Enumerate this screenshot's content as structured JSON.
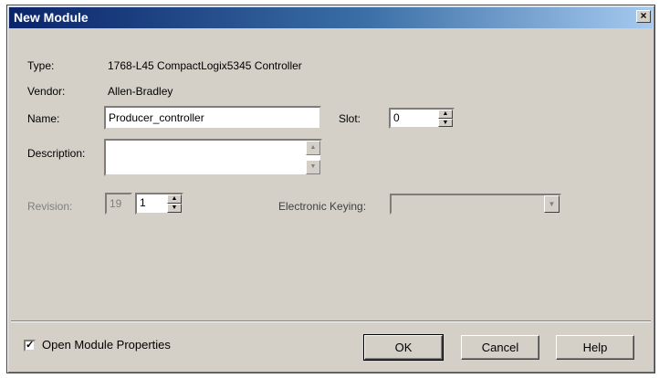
{
  "window": {
    "title": "New Module",
    "close_glyph": "×"
  },
  "form": {
    "type_label": "Type:",
    "type_value": "1768-L45 CompactLogix5345 Controller",
    "vendor_label": "Vendor:",
    "vendor_value": "Allen-Bradley",
    "name_label": "Name:",
    "name_value": "Producer_controller",
    "slot_label": "Slot:",
    "slot_value": "0",
    "description_label": "Description:",
    "description_value": "",
    "revision_label": "Revision:",
    "revision_major": "19",
    "revision_minor": "1",
    "keying_label": "Electronic Keying:",
    "keying_value": ""
  },
  "footer": {
    "open_props_checked": true,
    "open_props_check": "✓",
    "open_props_label": "Open Module Properties",
    "ok_label": "OK",
    "cancel_label": "Cancel",
    "help_label": "Help"
  },
  "icons": {
    "spin_up": "▲",
    "spin_down": "▼",
    "dropdown": "▼"
  }
}
